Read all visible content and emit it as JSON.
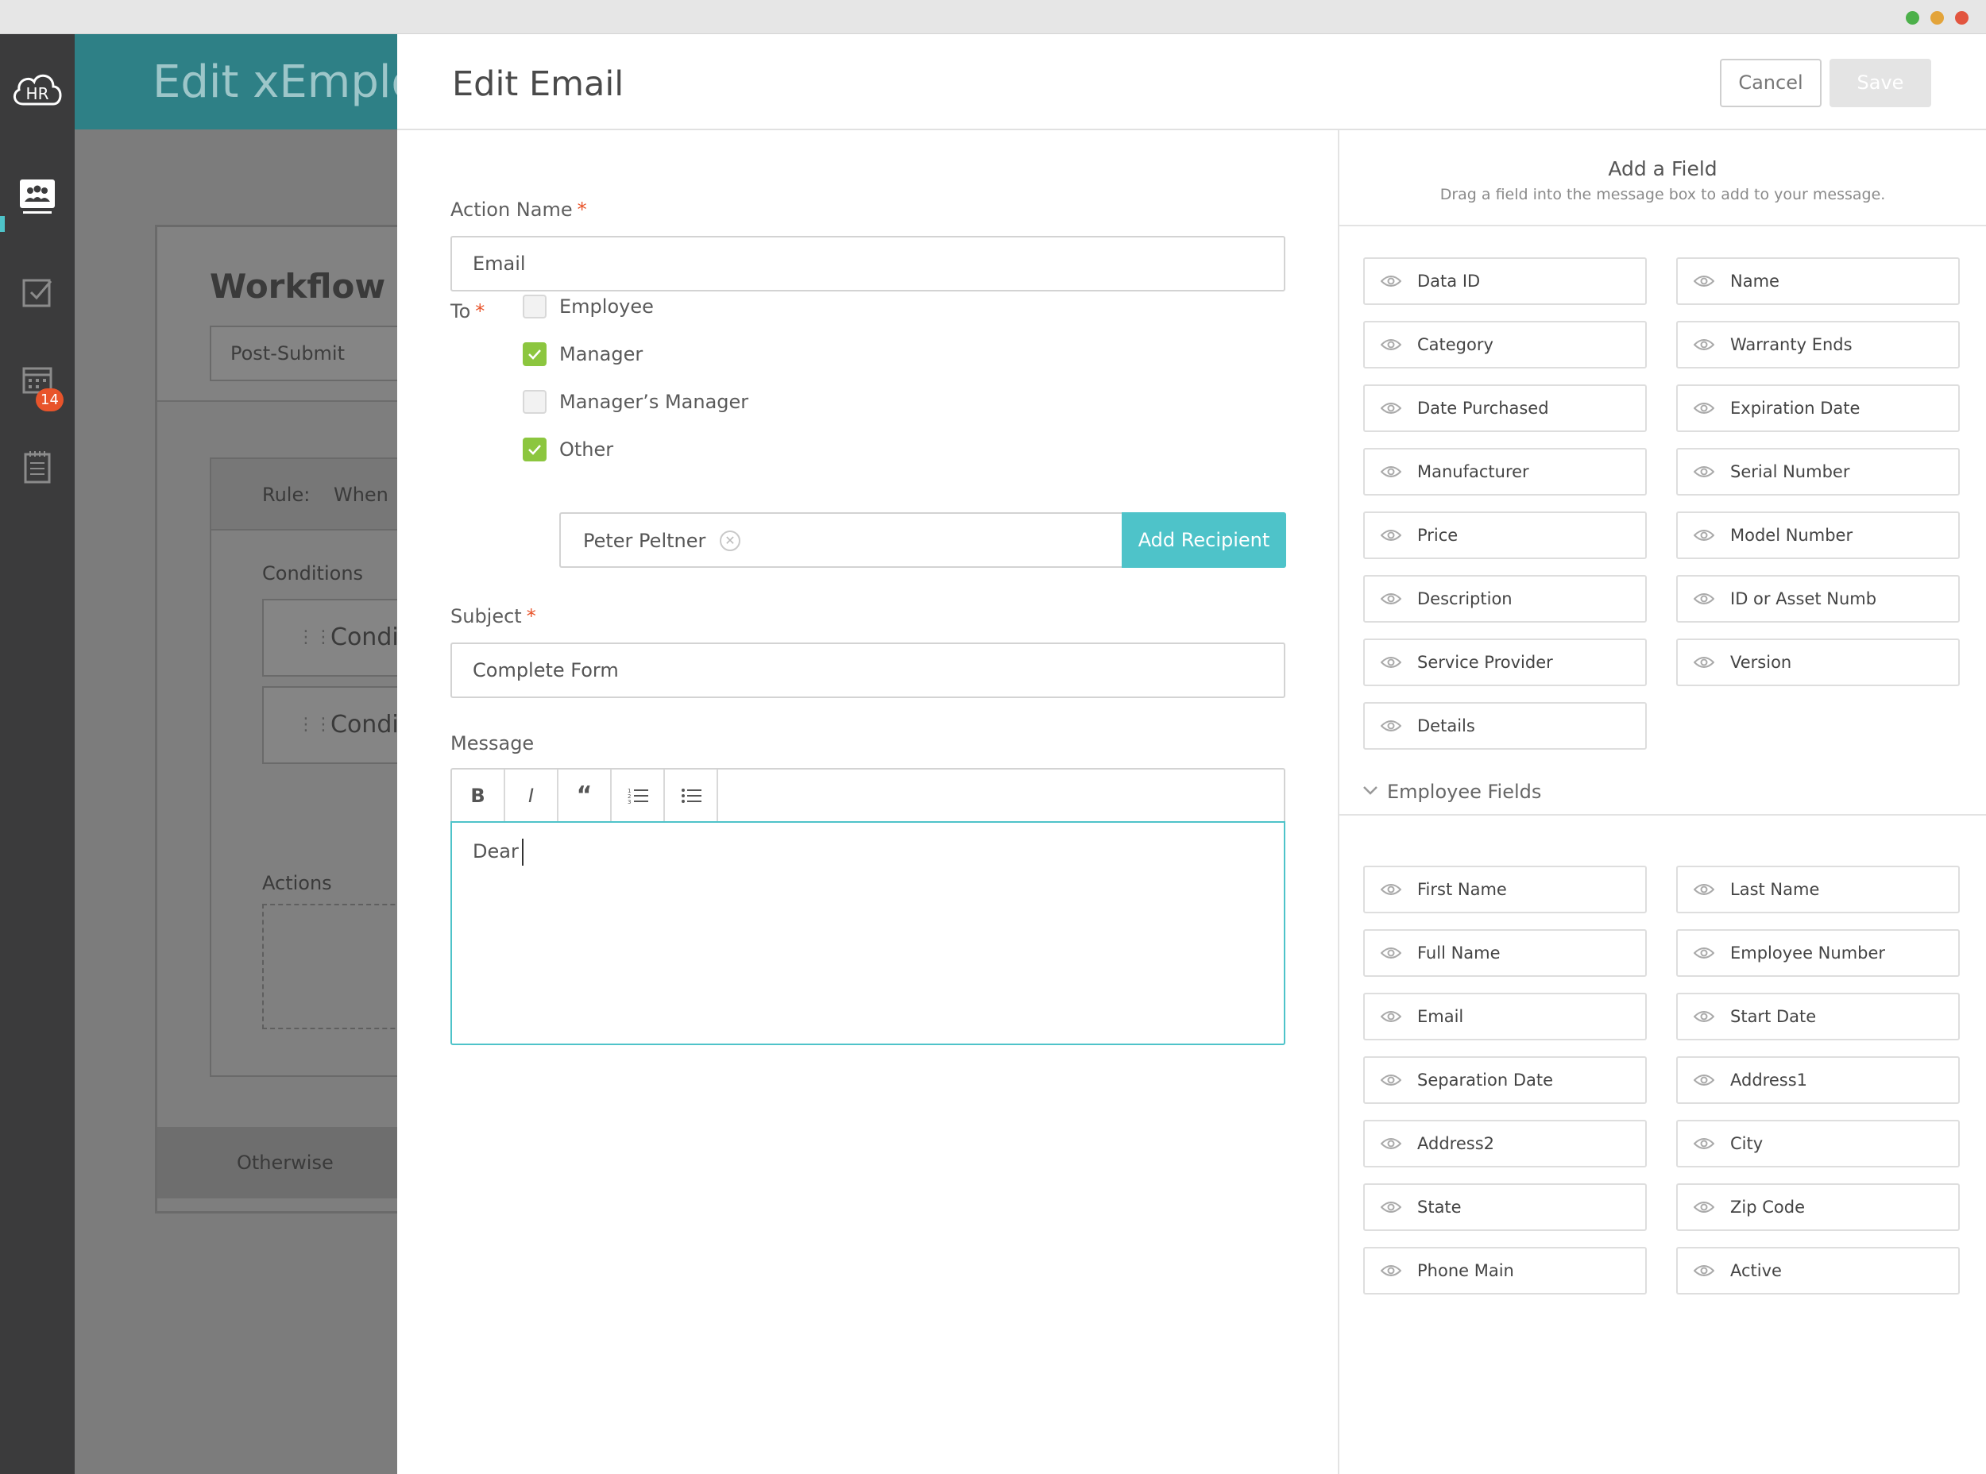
{
  "window": {
    "dots": [
      "#4cb04a",
      "#e3a43a",
      "#e2553f"
    ]
  },
  "rail": {
    "logo_text": "HR",
    "items": [
      {
        "icon": "people-icon",
        "active": true
      },
      {
        "icon": "checkbox-icon"
      },
      {
        "icon": "calendar-icon",
        "badge": "14"
      },
      {
        "icon": "notepad-icon"
      }
    ]
  },
  "background": {
    "page_title": "Edit xEmployee",
    "workflow_title": "Workflow Editor",
    "trigger_value": "Post-Submit",
    "rule_label": "Rule:",
    "rule_when": "When",
    "conditions_label": "Conditions",
    "conditions": [
      "Condition",
      "Condition"
    ],
    "actions_label": "Actions",
    "otherwise_label": "Otherwise"
  },
  "modal": {
    "title": "Edit Email",
    "cancel_label": "Cancel",
    "save_label": "Save",
    "required_mark": "*",
    "action_name": {
      "label": "Action Name",
      "value": "Email"
    },
    "to": {
      "label": "To",
      "options": [
        {
          "label": "Employee",
          "checked": false
        },
        {
          "label": "Manager",
          "checked": true
        },
        {
          "label": "Manager’s Manager",
          "checked": false
        },
        {
          "label": "Other",
          "checked": true
        }
      ],
      "recipient": "Peter Peltner",
      "add_recipient_label": "Add Recipient"
    },
    "subject": {
      "label": "Subject",
      "value": "Complete Form"
    },
    "message": {
      "label": "Message",
      "toolbar": [
        "B",
        "I",
        "“",
        "ordered-list-icon",
        "bullet-list-icon"
      ],
      "body": "Dear"
    }
  },
  "add_field": {
    "title": "Add a Field",
    "subtitle": "Drag a field into the message box to add to your message.",
    "form_fields": [
      "Data ID",
      "Name",
      "Category",
      "Warranty Ends",
      "Date Purchased",
      "Expiration Date",
      "Manufacturer",
      "Serial Number",
      "Price",
      "Model Number",
      "Description",
      "ID or Asset Numb",
      "Service Provider",
      "Version",
      "Details"
    ],
    "employee_section_title": "Employee Fields",
    "employee_fields": [
      "First Name",
      "Last Name",
      "Full Name",
      "Employee Number",
      "Email",
      "Start Date",
      "Separation Date",
      "Address1",
      "Address2",
      "City",
      "State",
      "Zip Code",
      "Phone Main",
      "Active"
    ]
  },
  "colors": {
    "accent": "#4ec3c9",
    "check": "#8cc63f",
    "required": "#e8542b",
    "badge": "#e8542b",
    "header_teal": "#2e8086"
  }
}
